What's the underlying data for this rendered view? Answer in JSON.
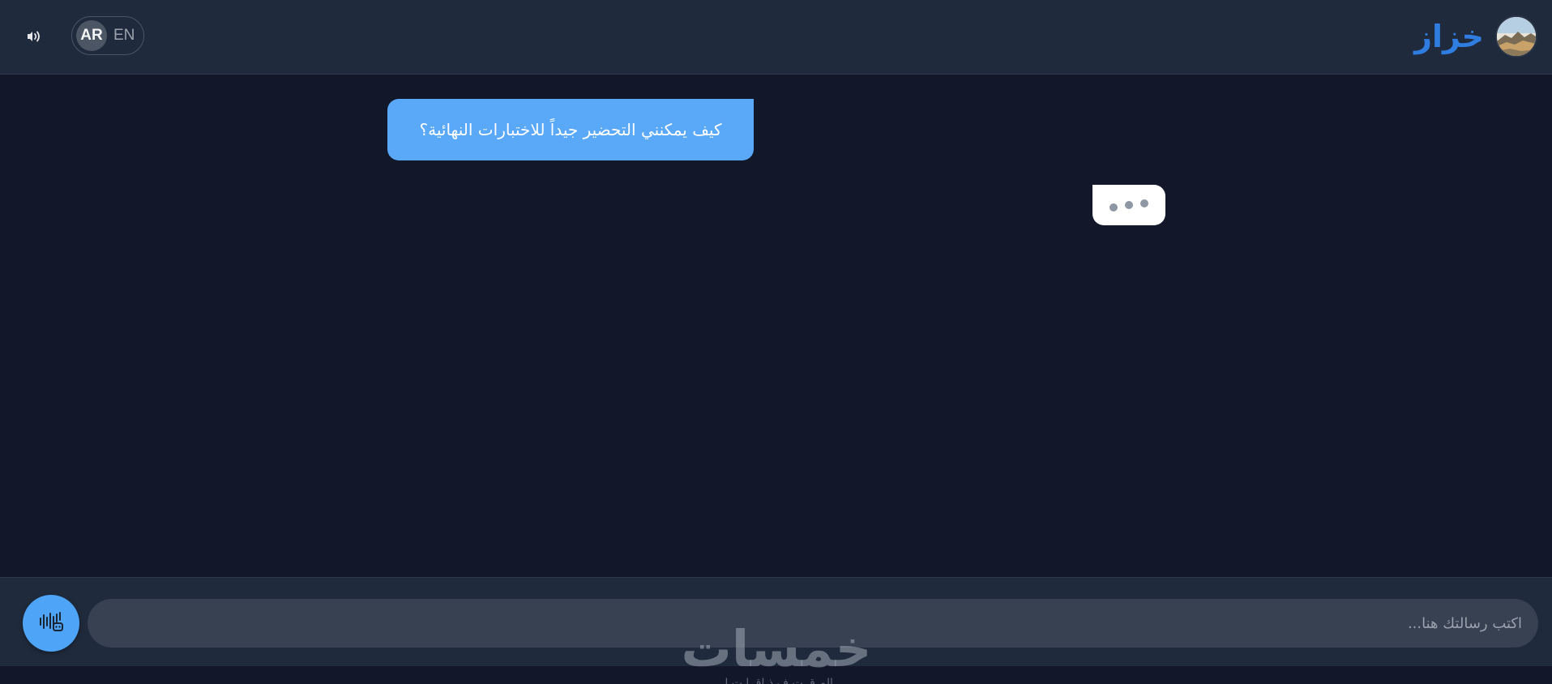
{
  "header": {
    "app_name": "خزاز",
    "avatar_icon": "landscape-avatar",
    "language": {
      "options": [
        "AR",
        "EN"
      ],
      "selected": "AR"
    },
    "sound_icon": "speaker-waves-icon"
  },
  "chat": {
    "messages": [
      {
        "role": "user",
        "text": "كيف يمكنني التحضير جيداً للاختبارات النهائية؟"
      }
    ],
    "typing_indicator": true
  },
  "composer": {
    "placeholder": "اكتب رسالتك هنا...",
    "value": "",
    "voice_icon": "voice-waveform-icon"
  },
  "watermark": {
    "logo_text": "خمسات",
    "tagline": "الم ق ت ف ذ اق ا ت ل"
  },
  "colors": {
    "background": "#121829",
    "header": "#1f2a3c",
    "accent": "#2f7de1",
    "user_bubble": "#5aa8f8",
    "input": "#374151"
  }
}
